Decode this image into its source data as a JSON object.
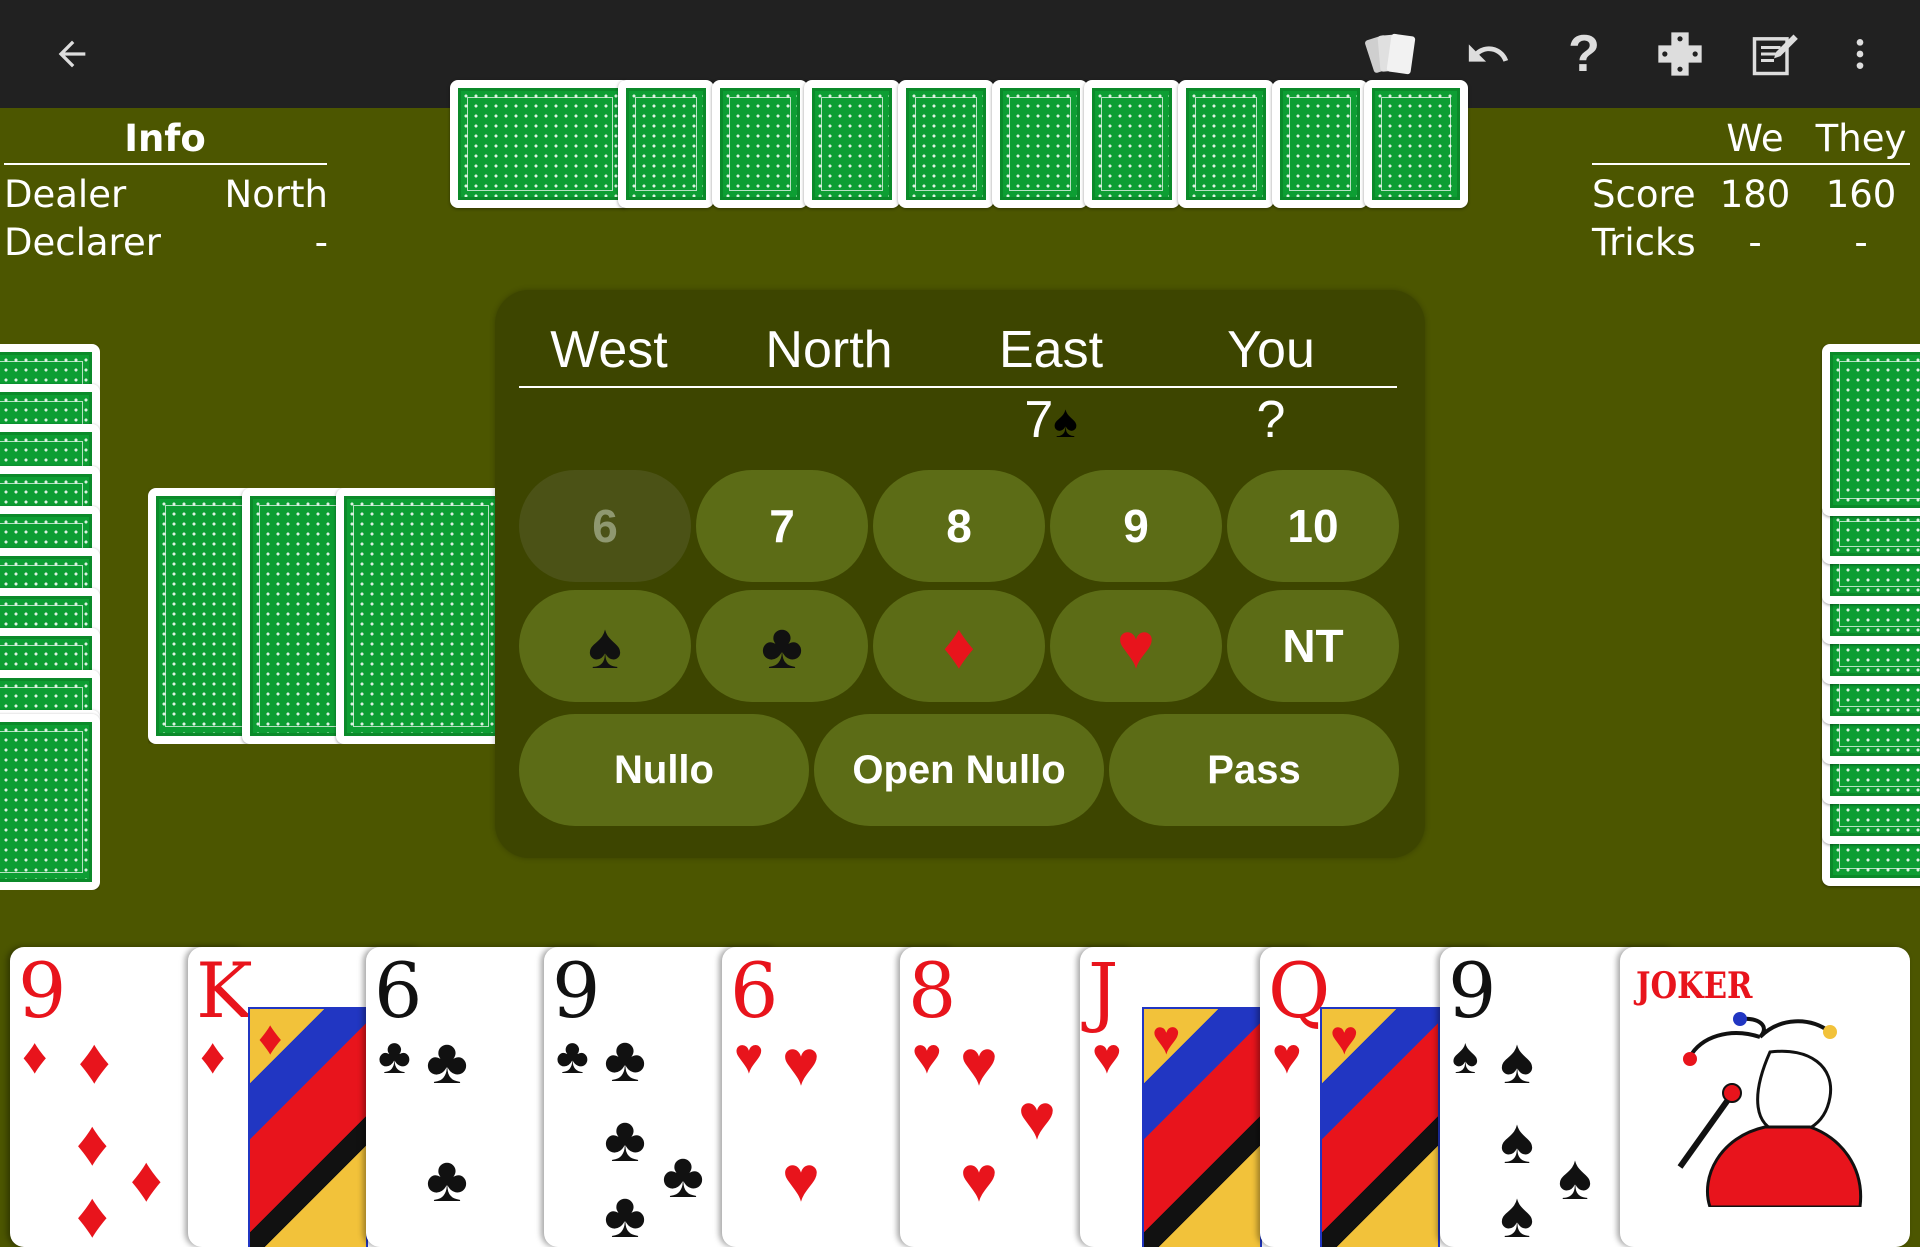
{
  "toolbar": {
    "back_icon": "arrow-left-icon",
    "actions": [
      "cards-icon",
      "undo-icon",
      "help-icon",
      "dpad-icon",
      "notepad-icon",
      "more-vert-icon"
    ]
  },
  "info": {
    "title": "Info",
    "rows": [
      {
        "label": "Dealer",
        "value": "North"
      },
      {
        "label": "Declarer",
        "value": "-"
      }
    ]
  },
  "score": {
    "headers": [
      "We",
      "They"
    ],
    "rows": [
      {
        "label": "Score",
        "we": "180",
        "they": "160"
      },
      {
        "label": "Tricks",
        "we": "-",
        "they": "-"
      }
    ]
  },
  "bidding": {
    "players": [
      "West",
      "North",
      "East",
      "You"
    ],
    "bids": [
      "",
      "",
      "7",
      "?"
    ],
    "east_bid_suit": "♠",
    "levels": [
      {
        "label": "6",
        "enabled": false
      },
      {
        "label": "7",
        "enabled": true
      },
      {
        "label": "8",
        "enabled": true
      },
      {
        "label": "9",
        "enabled": true
      },
      {
        "label": "10",
        "enabled": true
      }
    ],
    "suits": [
      {
        "glyph": "♠",
        "color": "#111111"
      },
      {
        "glyph": "♣",
        "color": "#111111"
      },
      {
        "glyph": "♦",
        "color": "#e8141c"
      },
      {
        "glyph": "♥",
        "color": "#e8141c"
      }
    ],
    "nt_label": "NT",
    "actions": [
      "Nullo",
      "Open Nullo",
      "Pass"
    ]
  },
  "hand": [
    {
      "rank": "9",
      "suit": "♦",
      "color": "red"
    },
    {
      "rank": "K",
      "suit": "♦",
      "color": "red"
    },
    {
      "rank": "6",
      "suit": "♣",
      "color": "black"
    },
    {
      "rank": "9",
      "suit": "♣",
      "color": "black"
    },
    {
      "rank": "6",
      "suit": "♥",
      "color": "red"
    },
    {
      "rank": "8",
      "suit": "♥",
      "color": "red"
    },
    {
      "rank": "J",
      "suit": "♥",
      "color": "red"
    },
    {
      "rank": "Q",
      "suit": "♥",
      "color": "red"
    },
    {
      "rank": "9",
      "suit": "♠",
      "color": "black"
    },
    {
      "rank": "JOKER",
      "suit": "",
      "color": "red"
    }
  ],
  "colors": {
    "table": "#4c5600",
    "toolbar": "#212121",
    "dialog": "#3d4500",
    "button": "#5c6c16",
    "card_back": "#0d9e33"
  }
}
